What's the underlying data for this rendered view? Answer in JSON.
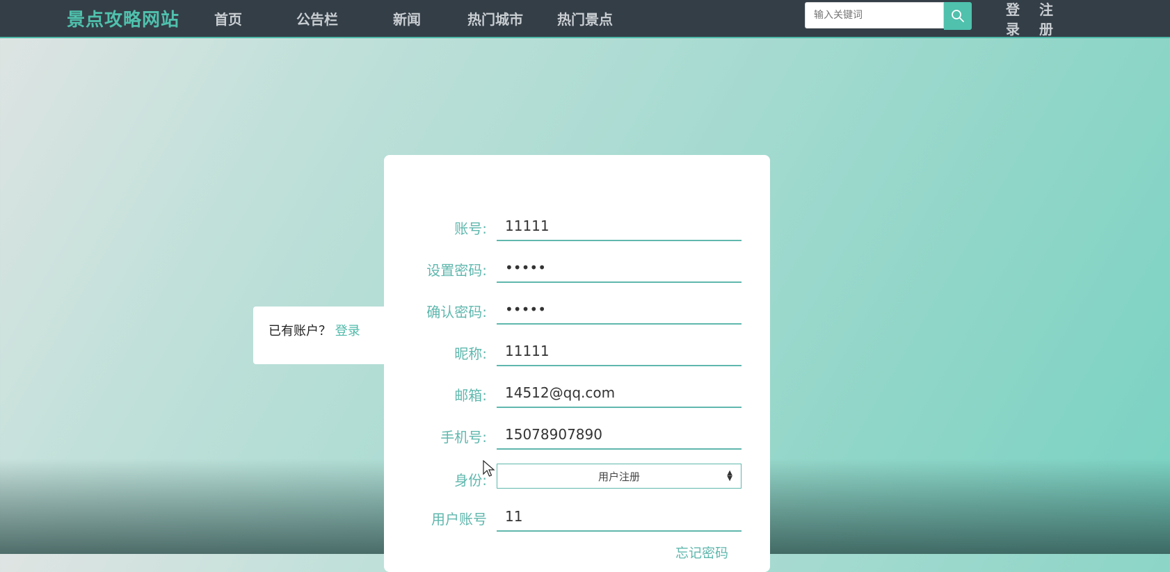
{
  "nav": {
    "brand": "景点攻略网站",
    "links": [
      "首页",
      "公告栏",
      "新闻",
      "热门城市",
      "热门景点"
    ],
    "search_placeholder": "输入关键词",
    "login": "登录",
    "register": "注册"
  },
  "side": {
    "prompt": "已有账户？",
    "login_link": "登录"
  },
  "form": {
    "fields": [
      {
        "label": "账号:",
        "value": "11111"
      },
      {
        "label": "设置密码:",
        "value": "•••••"
      },
      {
        "label": "确认密码:",
        "value": "•••••"
      },
      {
        "label": "昵称:",
        "value": "11111"
      },
      {
        "label": "邮箱:",
        "value": "14512@qq.com"
      },
      {
        "label": "手机号:",
        "value": "15078907890"
      }
    ],
    "identity_label": "身份:",
    "identity_value": "用户注册",
    "user_account_label": "用户账号",
    "user_account_value": "11",
    "forgot": "忘记密码"
  },
  "colors": {
    "accent": "#4fc1ad",
    "navbar": "#343e47"
  }
}
